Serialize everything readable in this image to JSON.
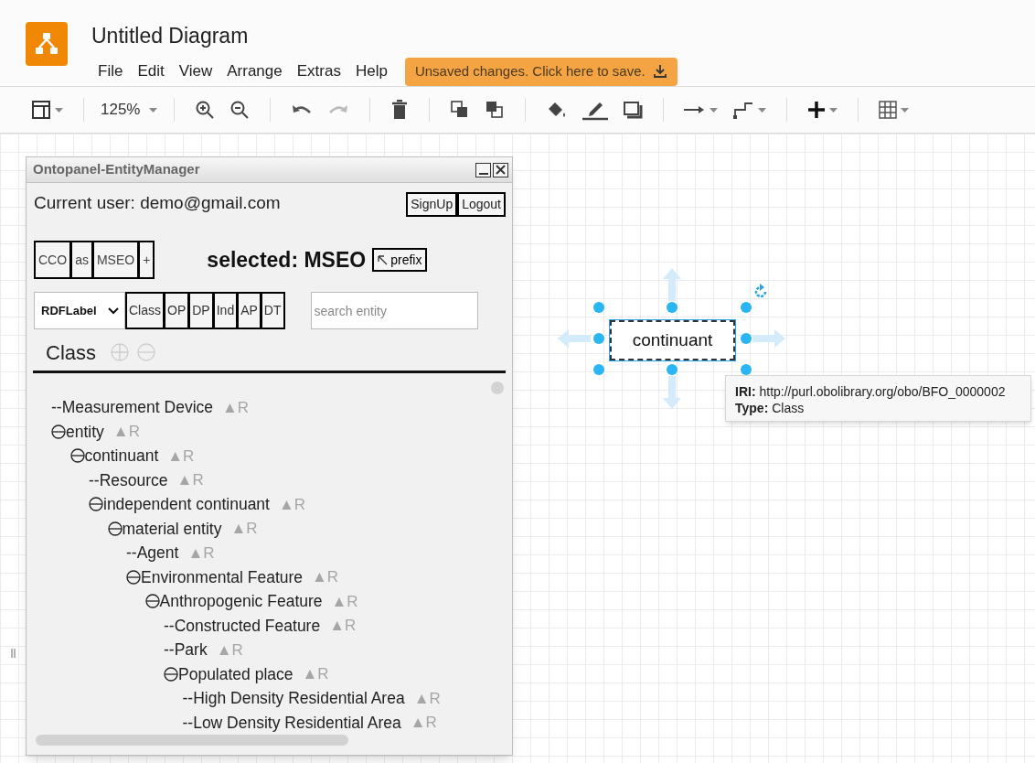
{
  "app": {
    "title": "Untitled Diagram",
    "menu": [
      "File",
      "Edit",
      "View",
      "Arrange",
      "Extras",
      "Help"
    ],
    "save_notice": "Unsaved changes. Click here to save."
  },
  "toolbar": {
    "zoom": "125%"
  },
  "panel": {
    "title": "Ontopanel-EntityManager",
    "current_user": "Current user: demo@gmail.com",
    "account_buttons": [
      "SignUp",
      "Logout"
    ],
    "ontologies": [
      "CCO",
      "as",
      "MSEO",
      "+"
    ],
    "selected_label": "selected: MSEO",
    "prefix_button": "prefix",
    "label_select": "RDFLabel",
    "entity_types": [
      "Class",
      "OP",
      "DP",
      "Ind",
      "AP",
      "DT"
    ],
    "search": {
      "placeholder": "search entity"
    },
    "section_title": "Class",
    "tree": [
      {
        "kind": "leaf",
        "label": "--Measurement Device",
        "suffix": "▲R"
      },
      {
        "kind": "node",
        "label": "entity",
        "suffix": "▲R",
        "expanded": true,
        "children": [
          {
            "kind": "node",
            "label": "continuant",
            "suffix": "▲R",
            "expanded": true,
            "children": [
              {
                "kind": "leaf",
                "label": "--Resource",
                "suffix": "▲R"
              },
              {
                "kind": "node",
                "label": "independent continuant",
                "suffix": "▲R",
                "expanded": true,
                "children": [
                  {
                    "kind": "node",
                    "label": "material entity",
                    "suffix": "▲R",
                    "expanded": true,
                    "children": [
                      {
                        "kind": "leaf",
                        "label": "--Agent",
                        "suffix": "▲R"
                      },
                      {
                        "kind": "node",
                        "label": "Environmental Feature",
                        "suffix": "▲R",
                        "expanded": true,
                        "children": [
                          {
                            "kind": "node",
                            "label": "Anthropogenic Feature",
                            "suffix": "▲R",
                            "expanded": true,
                            "children": [
                              {
                                "kind": "leaf",
                                "label": "--Constructed Feature",
                                "suffix": "▲R"
                              },
                              {
                                "kind": "leaf",
                                "label": "--Park",
                                "suffix": "▲R"
                              },
                              {
                                "kind": "node",
                                "label": "Populated place",
                                "suffix": "▲R",
                                "expanded": true,
                                "children": [
                                  {
                                    "kind": "leaf",
                                    "label": "--High Density Residential Area",
                                    "suffix": "▲R"
                                  },
                                  {
                                    "kind": "leaf",
                                    "label": "--Low Density Residential Area",
                                    "suffix": "▲R"
                                  }
                                ]
                              }
                            ]
                          }
                        ]
                      }
                    ]
                  }
                ]
              }
            ]
          }
        ]
      }
    ]
  },
  "diagram": {
    "shape_label": "continuant",
    "tooltip": {
      "iri": "**IRI:** http://purl.obolibrary.org/obo/BFO_0000002",
      "type": "**Type:** Class"
    }
  }
}
